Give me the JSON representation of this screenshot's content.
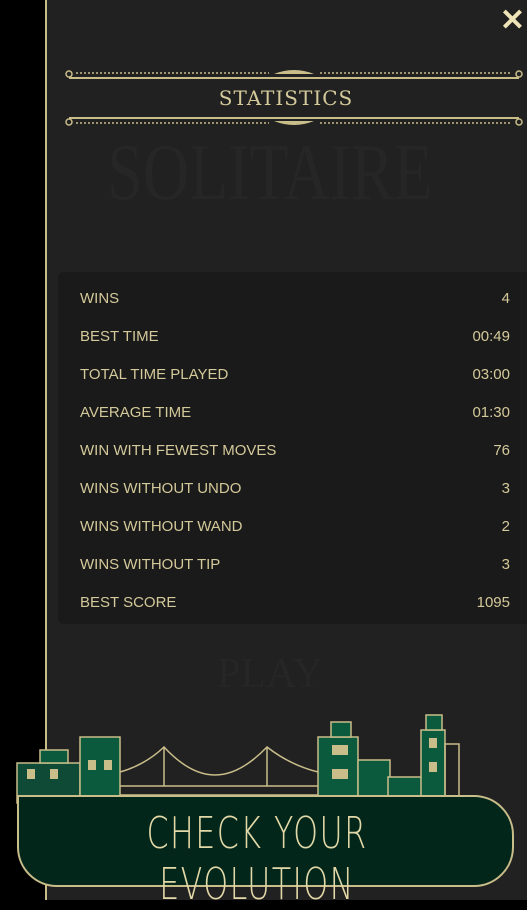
{
  "header": {
    "title": "STATISTICS",
    "close_icon": "close-icon"
  },
  "watermarks": {
    "top": "SOLITAIRE",
    "bottom": "PLAY"
  },
  "stats": [
    {
      "label": "WINS",
      "value": "4"
    },
    {
      "label": "BEST TIME",
      "value": "00:49"
    },
    {
      "label": "TOTAL TIME PLAYED",
      "value": "03:00"
    },
    {
      "label": "AVERAGE TIME",
      "value": "01:30"
    },
    {
      "label": "WIN WITH FEWEST MOVES",
      "value": "76"
    },
    {
      "label": "WINS WITHOUT UNDO",
      "value": "3"
    },
    {
      "label": "WINS WITHOUT WAND",
      "value": "2"
    },
    {
      "label": "WINS WITHOUT TIP",
      "value": "3"
    },
    {
      "label": "BEST SCORE",
      "value": "1095"
    }
  ],
  "evolution_button": {
    "label": "CHECK YOUR EVOLUTION"
  },
  "colors": {
    "background": "#212121",
    "gold": "#c9bd8a",
    "text": "#d4c99a",
    "button": "#02271a",
    "building": "#0b5a3e"
  }
}
